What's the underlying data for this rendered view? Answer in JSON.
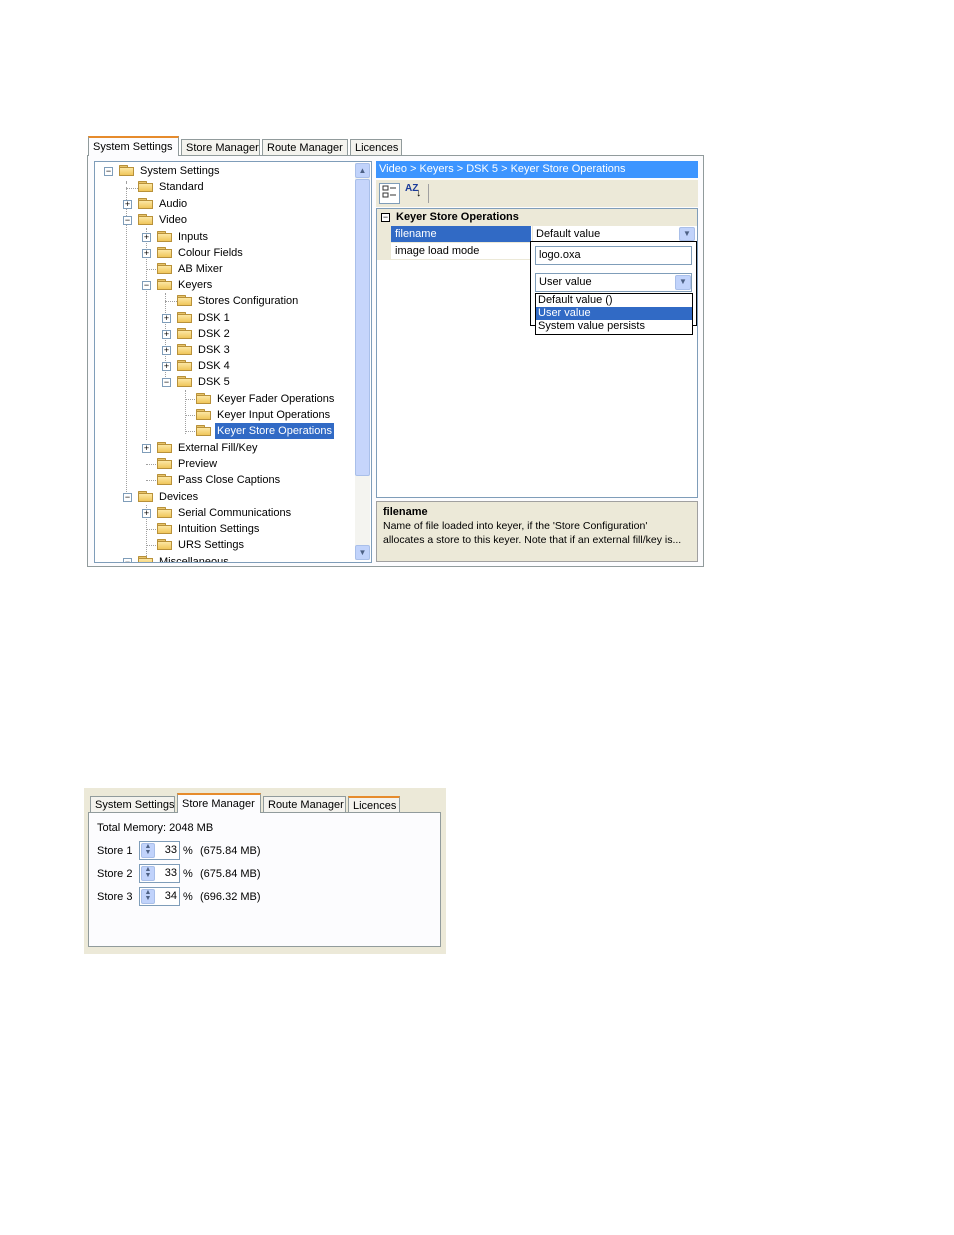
{
  "panel1": {
    "tabs": [
      {
        "label": "System Settings",
        "active": true
      },
      {
        "label": "Store Manager",
        "active": false
      },
      {
        "label": "Route Manager",
        "active": false
      },
      {
        "label": "Licences",
        "active": false
      }
    ],
    "tree": [
      {
        "label": "System Settings",
        "expander": "−"
      },
      {
        "label": "Standard",
        "expander": ""
      },
      {
        "label": "Audio",
        "expander": "+"
      },
      {
        "label": "Video",
        "expander": "−"
      },
      {
        "label": "Inputs",
        "expander": "+"
      },
      {
        "label": "Colour Fields",
        "expander": "+"
      },
      {
        "label": "AB Mixer",
        "expander": ""
      },
      {
        "label": "Keyers",
        "expander": "−"
      },
      {
        "label": "Stores Configuration",
        "expander": ""
      },
      {
        "label": "DSK 1",
        "expander": "+"
      },
      {
        "label": "DSK 2",
        "expander": "+"
      },
      {
        "label": "DSK 3",
        "expander": "+"
      },
      {
        "label": "DSK 4",
        "expander": "+"
      },
      {
        "label": "DSK 5",
        "expander": "−"
      },
      {
        "label": "Keyer Fader Operations",
        "expander": ""
      },
      {
        "label": "Keyer Input Operations",
        "expander": ""
      },
      {
        "label": "Keyer Store Operations",
        "expander": "",
        "selected": true
      },
      {
        "label": "External Fill/Key",
        "expander": "+"
      },
      {
        "label": "Preview",
        "expander": ""
      },
      {
        "label": "Pass Close Captions",
        "expander": ""
      },
      {
        "label": "Devices",
        "expander": "−"
      },
      {
        "label": "Serial Communications",
        "expander": "+"
      },
      {
        "label": "Intuition Settings",
        "expander": ""
      },
      {
        "label": "URS Settings",
        "expander": ""
      },
      {
        "label": "Miscellaneous",
        "expander": "−"
      }
    ],
    "breadcrumb": "Video > Keyers > DSK 5 > Keyer Store Operations",
    "toolbar": {
      "categorized_icon": "categorized-icon",
      "alphabetical_label": "AZ"
    },
    "grid": {
      "category": "Keyer Store Operations",
      "category_expander": "−",
      "properties": [
        {
          "name": "filename",
          "value": "Default value",
          "selected": true
        },
        {
          "name": "image load mode",
          "value": ""
        }
      ]
    },
    "popup": {
      "text_value": "logo.oxa",
      "combo_value": "User value",
      "options": [
        {
          "label": "Default value ()",
          "selected": false
        },
        {
          "label": "User value",
          "selected": true
        },
        {
          "label": "System value persists",
          "selected": false
        }
      ]
    },
    "description": {
      "title": "filename",
      "line1": "Name of file loaded into keyer, if the 'Store Configuration'",
      "line2": "allocates a store to this keyer. Note that if an external fill/key is..."
    }
  },
  "panel2": {
    "tabs": [
      {
        "label": "System Settings",
        "active": false
      },
      {
        "label": "Store Manager",
        "active": true
      },
      {
        "label": "Route Manager",
        "active": false
      },
      {
        "label": "Licences",
        "active": false
      }
    ],
    "total_memory": "Total Memory: 2048 MB",
    "stores": [
      {
        "label": "Store 1",
        "value": "33",
        "unit": "%",
        "size": "(675.84 MB)"
      },
      {
        "label": "Store 2",
        "value": "33",
        "unit": "%",
        "size": "(675.84 MB)"
      },
      {
        "label": "Store 3",
        "value": "34",
        "unit": "%",
        "size": "(696.32 MB)"
      }
    ]
  }
}
